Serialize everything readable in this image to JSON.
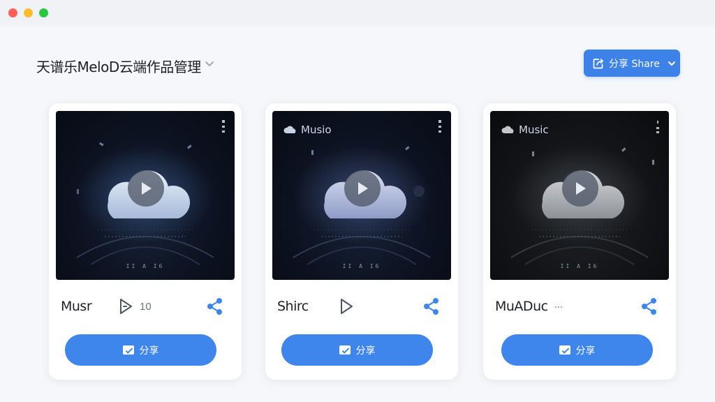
{
  "header": {
    "title": "天谱乐MeloD云端作品管理",
    "share_button_label": "分享 Share"
  },
  "cards": [
    {
      "name": "Musr",
      "brand": "",
      "play_count": "10",
      "caption": "II A I6",
      "share_label": "分享"
    },
    {
      "name": "Shirc",
      "brand": "Musio",
      "play_count": "",
      "caption": "II A I6",
      "share_label": "分享"
    },
    {
      "name": "MuADuc",
      "brand": "Music",
      "play_count": "",
      "caption": "II A I6",
      "share_label": "分享"
    }
  ],
  "colors": {
    "accent": "#3d82e8",
    "card_button": "#3f86ec",
    "window_bg": "#f6f7fa"
  },
  "icons": [
    "chevron-down-icon",
    "share-out-icon",
    "play-icon",
    "cloud-icon",
    "share-nodes-icon",
    "more-vertical-icon"
  ]
}
